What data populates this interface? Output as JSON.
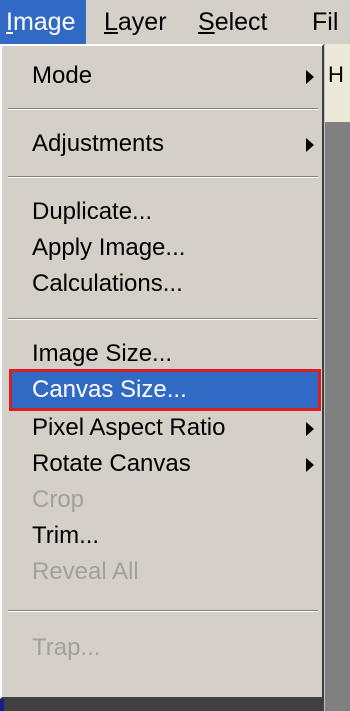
{
  "menubar": {
    "items": [
      {
        "mnemonic": "I",
        "rest": "mage",
        "active": true
      },
      {
        "mnemonic": "L",
        "rest": "ayer",
        "active": false
      },
      {
        "mnemonic": "S",
        "rest": "elect",
        "active": false
      },
      {
        "mnemonic": "",
        "rest": "Fil",
        "active": false
      }
    ]
  },
  "background_glyph": "H",
  "dropdown": {
    "items": [
      {
        "label": "Mode",
        "submenu": true,
        "disabled": false
      },
      {
        "label": "Adjustments",
        "submenu": true,
        "disabled": false
      },
      {
        "label": "Duplicate...",
        "submenu": false,
        "disabled": false
      },
      {
        "label": "Apply Image...",
        "submenu": false,
        "disabled": false
      },
      {
        "label": "Calculations...",
        "submenu": false,
        "disabled": false
      },
      {
        "label": "Image Size...",
        "submenu": false,
        "disabled": false
      },
      {
        "label": "Canvas Size...",
        "submenu": false,
        "disabled": false,
        "highlighted": true
      },
      {
        "label": "Pixel Aspect Ratio",
        "submenu": true,
        "disabled": false
      },
      {
        "label": "Rotate Canvas",
        "submenu": true,
        "disabled": false
      },
      {
        "label": "Crop",
        "submenu": false,
        "disabled": true
      },
      {
        "label": "Trim...",
        "submenu": false,
        "disabled": false
      },
      {
        "label": "Reveal All",
        "submenu": false,
        "disabled": true
      },
      {
        "label": "Trap...",
        "submenu": false,
        "disabled": true
      }
    ]
  },
  "colors": {
    "highlight": "#316ac5",
    "outline": "#d91f26",
    "disabled_text": "#a3a099"
  }
}
